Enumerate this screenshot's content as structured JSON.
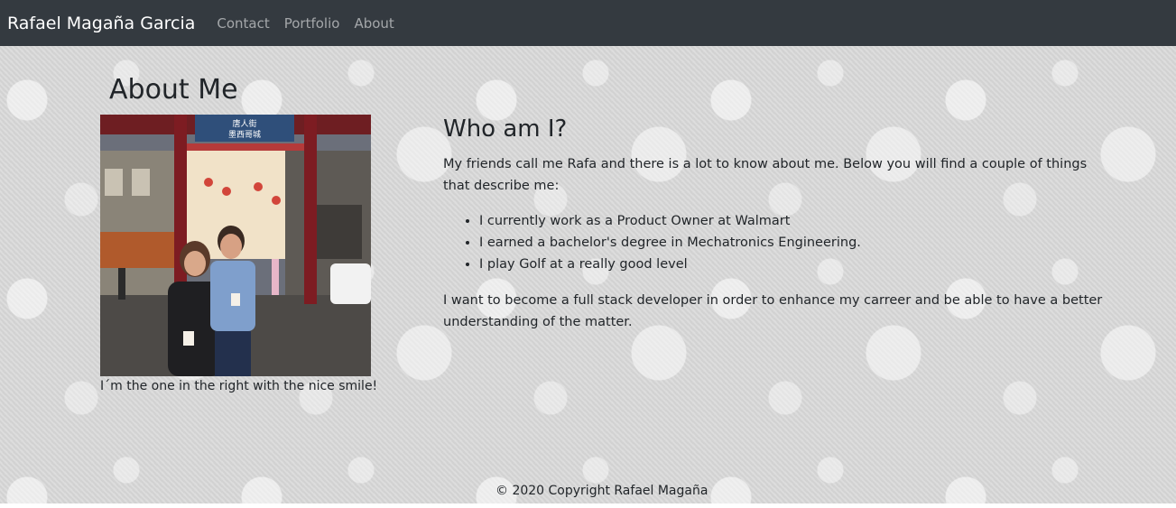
{
  "navbar": {
    "brand": "Rafael Magaña Garcia",
    "links": [
      {
        "label": "Contact"
      },
      {
        "label": "Portfolio"
      },
      {
        "label": "About"
      }
    ],
    "background": "#343a40"
  },
  "about": {
    "title": "About Me",
    "photo_caption": "I´m the one in the right with the nice smile!"
  },
  "who": {
    "title": "Who am I?",
    "intro": "My friends call me Rafa and there is a lot to know about me. Below you will find a couple of things that describe me:",
    "facts": [
      "I currently work as a Product Owner at Walmart",
      "I earned a bachelor's degree in Mechatronics Engineering.",
      "I play Golf at a really good level"
    ],
    "goal": "I want to become a full stack developer in order to enhance my carreer and be able to have a better understanding of the matter."
  },
  "photo_sign": {
    "line1": "唐人街",
    "line2": "墨西哥城"
  },
  "footer": {
    "copyright": "© 2020 Copyright Rafael Magaña"
  }
}
